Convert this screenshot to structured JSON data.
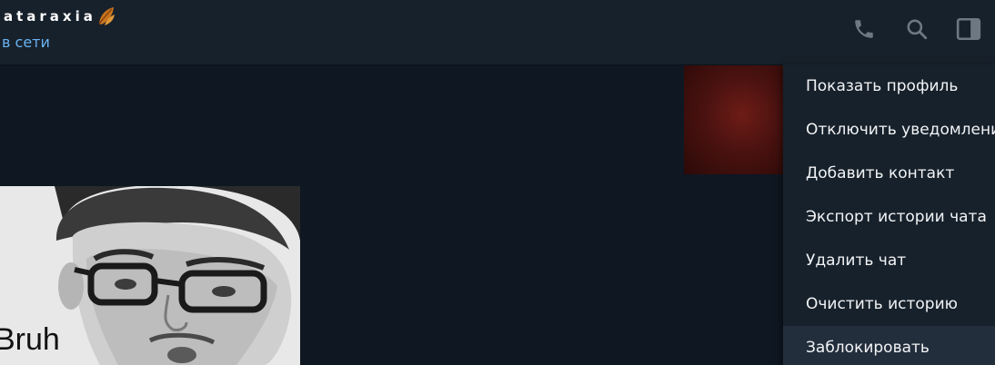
{
  "header": {
    "chat_name": "ataraxia",
    "status": "в сети",
    "name_emoji_icon": "fallen-leaf-icon",
    "buttons": [
      {
        "icon": "phone-icon"
      },
      {
        "icon": "search-icon"
      },
      {
        "icon": "sidebar-panel-icon"
      }
    ]
  },
  "messages": {
    "meme_caption": "Bruh"
  },
  "menu": {
    "items": [
      {
        "label": "Показать профиль"
      },
      {
        "label": "Отключить уведомления"
      },
      {
        "label": "Добавить контакт"
      },
      {
        "label": "Экспорт истории чата"
      },
      {
        "label": "Удалить чат"
      },
      {
        "label": "Очистить историю"
      },
      {
        "label": "Заблокировать"
      }
    ],
    "highlighted_index": 6
  },
  "colors": {
    "header_bg": "#17212b",
    "chat_bg": "#0f1722",
    "status_blue": "#6ab3f3",
    "menu_bg": "#17212b",
    "menu_hover": "#232e3c",
    "icon_gray": "#6d7883"
  }
}
